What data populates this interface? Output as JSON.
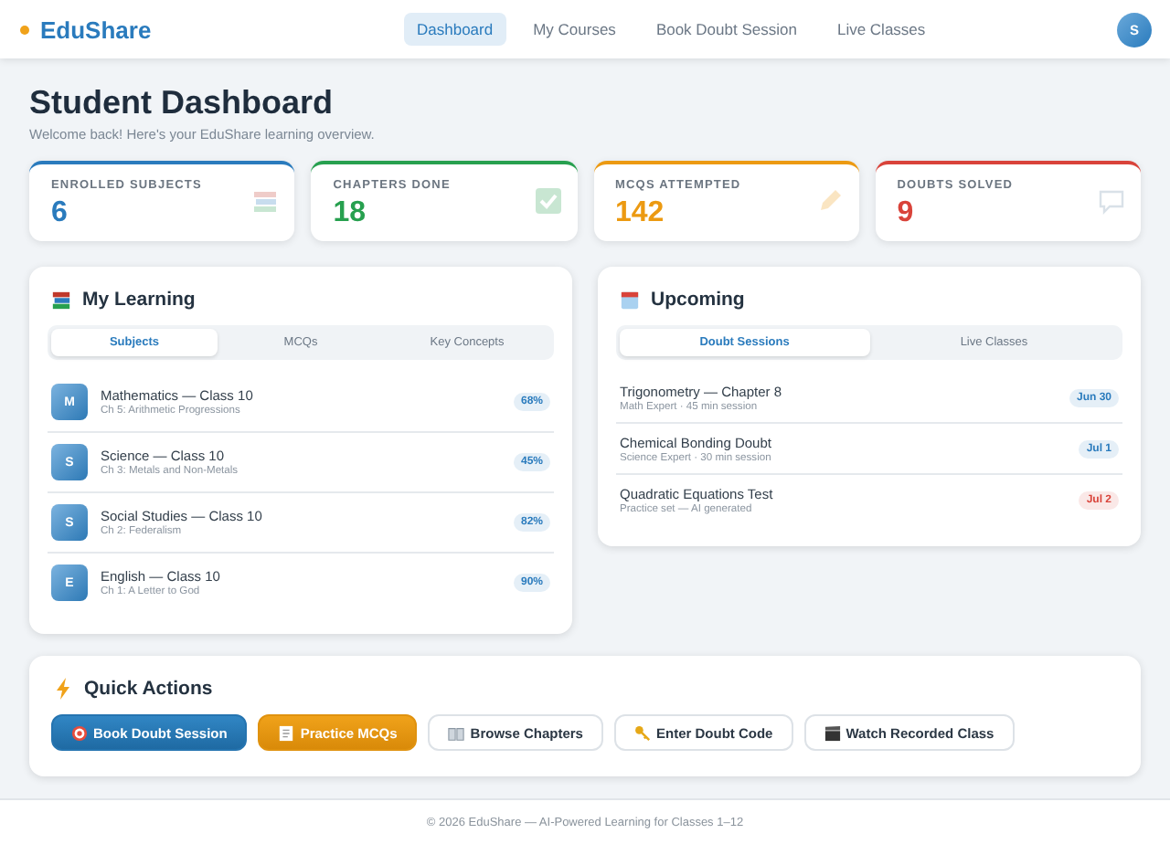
{
  "brand": "EduShare",
  "nav": [
    {
      "label": "Dashboard",
      "selected": true
    },
    {
      "label": "My Courses",
      "selected": false
    },
    {
      "label": "Book Doubt Session",
      "selected": false
    },
    {
      "label": "Live Classes",
      "selected": false
    }
  ],
  "avatar": "S",
  "title": "Student Dashboard",
  "subtitle": "Welcome back! Here's your EduShare learning overview.",
  "stats": [
    {
      "label": "ENROLLED SUBJECTS",
      "value": "6",
      "color": "#2a7bbd",
      "kind": "books"
    },
    {
      "label": "CHAPTERS DONE",
      "value": "18",
      "color": "#27a04f",
      "kind": "check"
    },
    {
      "label": "MCQS ATTEMPTED",
      "value": "142",
      "color": "#ec9a12",
      "kind": "pencil"
    },
    {
      "label": "DOUBTS SOLVED",
      "value": "9",
      "color": "#d9433a",
      "kind": "speech"
    }
  ],
  "learning": {
    "title": "My Learning",
    "tabs": [
      {
        "label": "Subjects",
        "selected": true
      },
      {
        "label": "MCQs",
        "selected": false
      },
      {
        "label": "Key Concepts",
        "selected": false
      }
    ],
    "subjects": [
      {
        "initial": "M",
        "name": "Mathematics — Class 10",
        "chapter": "Ch 5: Arithmetic Progressions",
        "progress": "68%"
      },
      {
        "initial": "S",
        "name": "Science — Class 10",
        "chapter": "Ch 3: Metals and Non-Metals",
        "progress": "45%"
      },
      {
        "initial": "S",
        "name": "Social Studies — Class 10",
        "chapter": "Ch 2: Federalism",
        "progress": "82%"
      },
      {
        "initial": "E",
        "name": "English — Class 10",
        "chapter": "Ch 1: A Letter to God",
        "progress": "90%"
      }
    ]
  },
  "upcoming": {
    "title": "Upcoming",
    "tabs": [
      {
        "label": "Doubt Sessions",
        "selected": true
      },
      {
        "label": "Live Classes",
        "selected": false
      }
    ],
    "items": [
      {
        "title": "Trigonometry — Chapter 8",
        "detail": "Math Expert · 45 min session",
        "date": "Jun 30",
        "color": "#2a7bbd"
      },
      {
        "title": "Chemical Bonding Doubt",
        "detail": "Science Expert · 30 min session",
        "date": "Jul 1",
        "color": "#2a7bbd"
      },
      {
        "title": "Quadratic Equations Test",
        "detail": "Practice set — AI generated",
        "date": "Jul 2",
        "color": "#d9433a"
      }
    ]
  },
  "quick_actions": {
    "title": "Quick Actions",
    "buttons": [
      {
        "label": "Book Doubt Session",
        "kind": "primary"
      },
      {
        "label": "Practice MCQs",
        "kind": "warning"
      },
      {
        "label": "Browse Chapters",
        "kind": "outline"
      },
      {
        "label": "Enter Doubt Code",
        "kind": "outline"
      },
      {
        "label": "Watch Recorded Class",
        "kind": "outline"
      }
    ]
  },
  "footer": "© 2026 EduShare — AI-Powered Learning for Classes 1–12"
}
